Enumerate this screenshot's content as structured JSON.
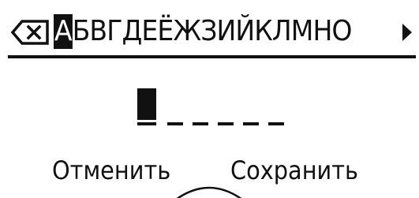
{
  "letter_bar": {
    "backspace_icon": "backspace-icon",
    "selected_letter": "А",
    "letters": "БВГДЕЁЖЗИЙКЛМНО",
    "next_icon": "triangle-right-icon"
  },
  "entry": {
    "cursor_icon": "block-cursor",
    "placeholder_slots": 5
  },
  "softkeys": {
    "cancel_label": "Отменить",
    "save_label": "Сохранить"
  },
  "colors": {
    "foreground": "#111111",
    "background": "#ffffff"
  }
}
